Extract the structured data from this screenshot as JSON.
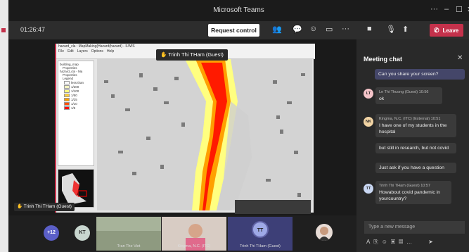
{
  "app": {
    "title": "Microsoft Teams"
  },
  "toolbar": {
    "timer": "01:26:47",
    "request_control": "Request control",
    "leave": "Leave",
    "participants_count": "6"
  },
  "share": {
    "window_title": "hazard_cla : MapMaking(Hazard(hazard) - ILWIS",
    "menus": [
      "File",
      "Edit",
      "Layers",
      "Options",
      "Help"
    ],
    "toc_items": [
      "building_map",
      "Properties",
      "hazard_cla - Ma",
      "Properties",
      "Legend"
    ],
    "legend": [
      {
        "label": "less than",
        "color": "#ffffff"
      },
      {
        "label": "1/200",
        "color": "#f3f3c0"
      },
      {
        "label": "1/100",
        "color": "#ffff80"
      },
      {
        "label": "1/50",
        "color": "#ffd040"
      },
      {
        "label": "1/25",
        "color": "#ffa000"
      },
      {
        "label": "1/10",
        "color": "#ff5000"
      },
      {
        "label": "1/5",
        "color": "#ff0000"
      }
    ],
    "raising_hand_tooltip": "Trinh Thi THam (Guest)",
    "presenter_badge": "Trinh Thi THam (Guest)"
  },
  "chat": {
    "title": "Meeting chat",
    "messages": [
      {
        "initials": "",
        "author": "",
        "time": "",
        "text": "Can you share your screen?",
        "mine": true
      },
      {
        "initials": "LT",
        "author": "Le Thi Thuong (Guest)",
        "time": "10:56",
        "text": "ok",
        "mine": false,
        "avatar_color": "#f4c3c8"
      },
      {
        "initials": "NK",
        "author": "Kingma, N.C. (ITC) (External)",
        "time": "10:51",
        "text": "I have one of my students in the hospital",
        "mine": false,
        "avatar_color": "#f2d4a4"
      },
      {
        "initials": "",
        "author": "",
        "time": "",
        "text": "but still in research, but not covid",
        "mine": false
      },
      {
        "initials": "",
        "author": "",
        "time": "",
        "text": "Just ask if you have a question",
        "mine": false
      },
      {
        "initials": "TT",
        "author": "Trinh Thi THam (Guest)",
        "time": "10:57",
        "text": "Howabout covid pandemic in yourcountry?",
        "mine": false,
        "avatar_color": "#c9d7f2"
      }
    ],
    "compose_placeholder": "Type a new message"
  },
  "participants": [
    {
      "label": "+12",
      "kind": "overflow"
    },
    {
      "label": "KT",
      "kind": "avatar"
    },
    {
      "label": "Tran The Viet",
      "kind": "video"
    },
    {
      "label": "Kingma, N.C. (ITC)",
      "kind": "video"
    },
    {
      "label": "Trinh Thi THam (Guest)",
      "kind": "avatar",
      "initials": "TT"
    },
    {
      "label": "",
      "kind": "video"
    }
  ]
}
